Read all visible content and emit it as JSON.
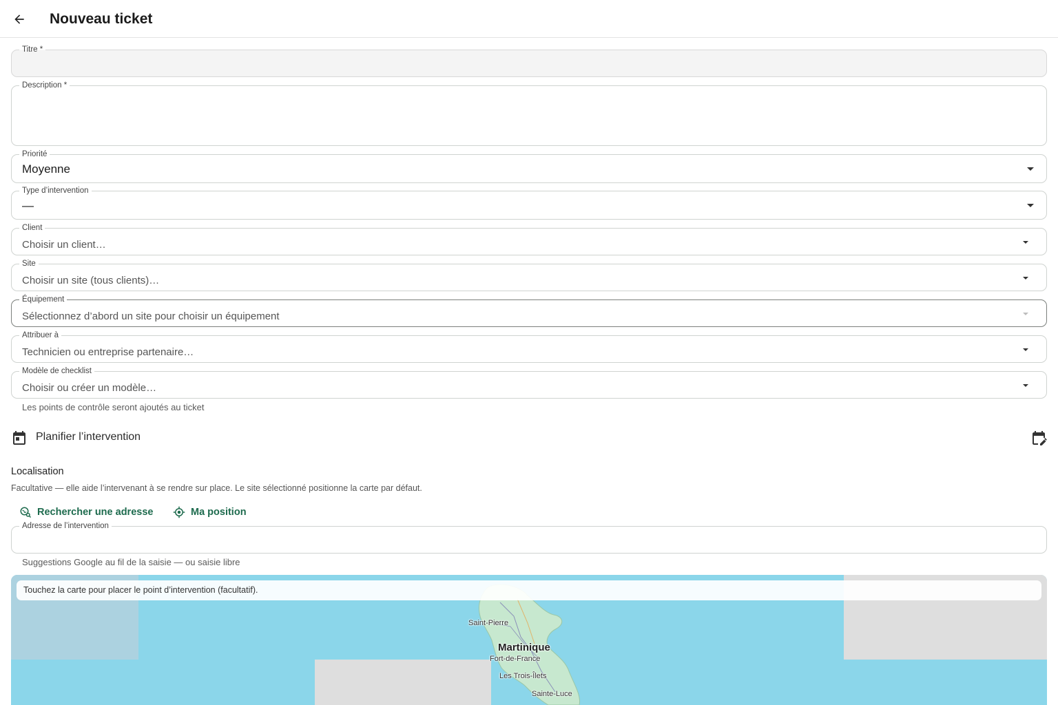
{
  "header": {
    "title": "Nouveau ticket"
  },
  "form": {
    "titre": {
      "label": "Titre *",
      "value": ""
    },
    "description": {
      "label": "Description *",
      "value": ""
    },
    "priorite": {
      "label": "Priorité",
      "value": "Moyenne"
    },
    "type_intervention": {
      "label": "Type d’intervention",
      "value": "—"
    },
    "client": {
      "label": "Client",
      "placeholder": "Choisir un client…"
    },
    "site": {
      "label": "Site",
      "placeholder": "Choisir un site (tous clients)…"
    },
    "equipement": {
      "label": "Équipement",
      "placeholder": "Sélectionnez d’abord un site pour choisir un équipement"
    },
    "attribuer": {
      "label": "Attribuer à",
      "placeholder": "Technicien ou entreprise partenaire…"
    },
    "checklist": {
      "label": "Modèle de checklist",
      "placeholder": "Choisir ou créer un modèle…",
      "helper": "Les points de contrôle seront ajoutés au ticket"
    }
  },
  "schedule": {
    "label": "Planifier l’intervention"
  },
  "location": {
    "title": "Localisation",
    "subtitle": "Facultative — elle aide l’intervenant à se rendre sur place. Le site sélectionné positionne la carte par défaut.",
    "search_label": "Rechercher une adresse",
    "position_label": "Ma position",
    "address": {
      "label": "Adresse de l’intervention",
      "value": "",
      "helper": "Suggestions Google au fil de la saisie — ou saisie libre"
    }
  },
  "map": {
    "hint": "Touchez la carte pour placer le point d’intervention (facultatif).",
    "labels": {
      "saint_pierre": "Saint-Pierre",
      "martinique": "Martinique",
      "fort_de_france": "Fort-de-France",
      "trois_ilets": "Les Trois-Îlets",
      "sainte_luce": "Sainte-Luce"
    }
  },
  "colors": {
    "accent": "#1e6b4e",
    "sea": "#8bd6ea",
    "land": "#c7e8cf"
  }
}
